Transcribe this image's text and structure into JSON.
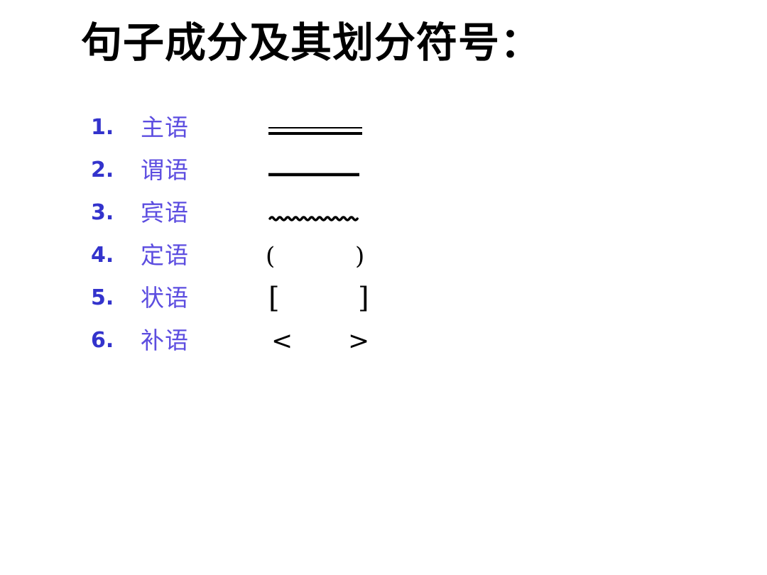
{
  "slide": {
    "background_color": "#ffffff",
    "title": "句子成分及其划分符号：",
    "title_color": "#000000",
    "number_color": "#3333cc",
    "label_color": "#5c4de0",
    "marker_color": "#000000"
  },
  "items": [
    {
      "number": "1.",
      "label": "主语",
      "marker_type": "double-line",
      "marker_open": "",
      "marker_close": ""
    },
    {
      "number": "2.",
      "label": "谓语",
      "marker_type": "single-line",
      "marker_open": "",
      "marker_close": ""
    },
    {
      "number": "3.",
      "label": "宾语",
      "marker_type": "wavy-line",
      "marker_open": "",
      "marker_close": ""
    },
    {
      "number": "4.",
      "label": "定语",
      "marker_type": "parentheses",
      "marker_open": "(",
      "marker_close": ")"
    },
    {
      "number": "5.",
      "label": "状语",
      "marker_type": "square-brackets",
      "marker_open": "[",
      "marker_close": "]"
    },
    {
      "number": "6.",
      "label": "补语",
      "marker_type": "angle-brackets",
      "marker_open": "<",
      "marker_close": ">"
    }
  ]
}
